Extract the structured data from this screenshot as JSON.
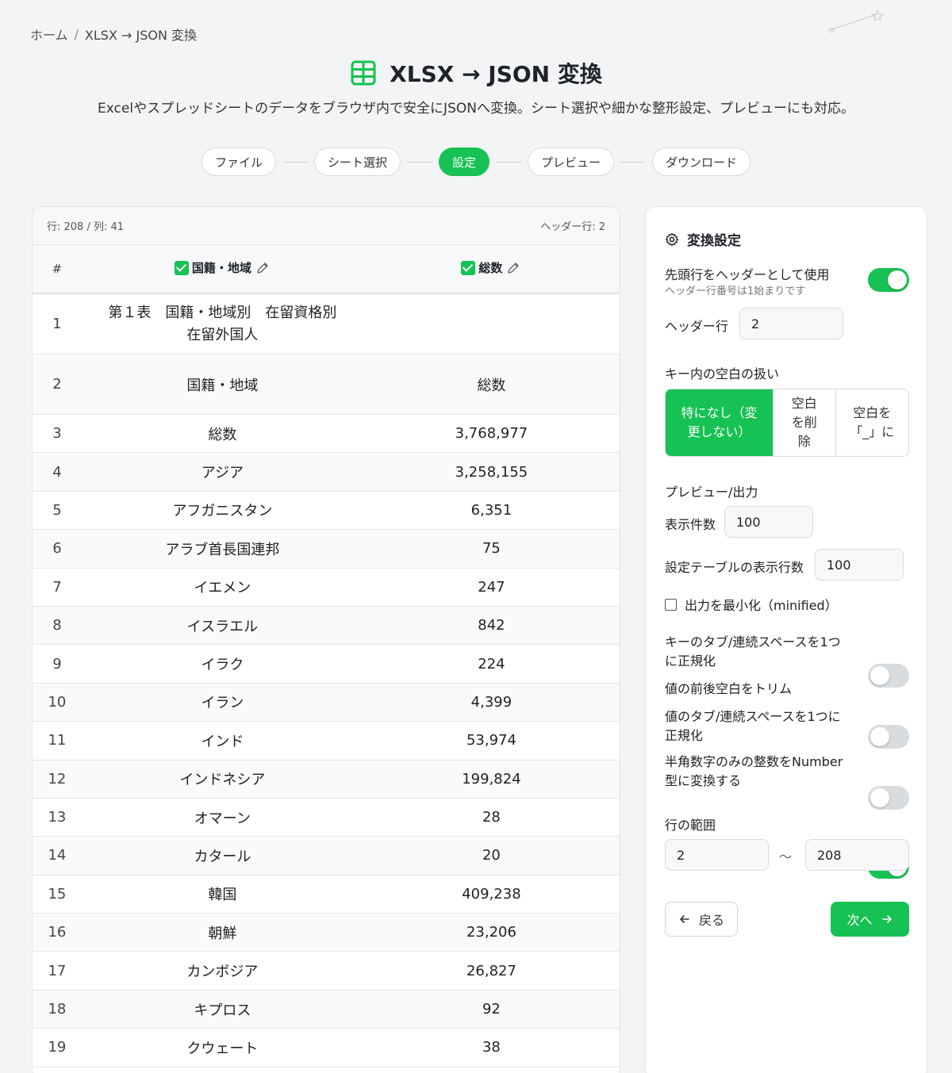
{
  "breadcrumb": {
    "home": "ホーム",
    "separator": "/",
    "current": "XLSX → JSON 変換"
  },
  "header": {
    "title": "XLSX → JSON 変換",
    "icon": "table-icon",
    "subtitle": "Excelやスプレッドシートのデータをブラウザ内で安全にJSONへ変換。シート選択や細かな整形設定、プレビューにも対応。"
  },
  "steps": [
    {
      "label": "ファイル",
      "active": false
    },
    {
      "label": "シート選択",
      "active": false
    },
    {
      "label": "設定",
      "active": true
    },
    {
      "label": "プレビュー",
      "active": false
    },
    {
      "label": "ダウンロード",
      "active": false
    }
  ],
  "table": {
    "meta_left": "行: 208 / 列: 41",
    "meta_right": "ヘッダー行: 2",
    "columns": {
      "num": "#",
      "a": "国籍・地域",
      "b": "総数"
    },
    "rows": [
      {
        "n": "1",
        "a": "第１表　国籍・地域別　在留資格別\n在留外国人",
        "b": ""
      },
      {
        "n": "2",
        "a": "国籍・地域",
        "b": "総数"
      },
      {
        "n": "3",
        "a": "総数",
        "b": "3,768,977"
      },
      {
        "n": "4",
        "a": "アジア",
        "b": "3,258,155"
      },
      {
        "n": "5",
        "a": "アフガニスタン",
        "b": "6,351"
      },
      {
        "n": "6",
        "a": "アラブ首長国連邦",
        "b": "75"
      },
      {
        "n": "7",
        "a": "イエメン",
        "b": "247"
      },
      {
        "n": "8",
        "a": "イスラエル",
        "b": "842"
      },
      {
        "n": "9",
        "a": "イラク",
        "b": "224"
      },
      {
        "n": "10",
        "a": "イラン",
        "b": "4,399"
      },
      {
        "n": "11",
        "a": "インド",
        "b": "53,974"
      },
      {
        "n": "12",
        "a": "インドネシア",
        "b": "199,824"
      },
      {
        "n": "13",
        "a": "オマーン",
        "b": "28"
      },
      {
        "n": "14",
        "a": "カタール",
        "b": "20"
      },
      {
        "n": "15",
        "a": "韓国",
        "b": "409,238"
      },
      {
        "n": "16",
        "a": "朝鮮",
        "b": "23,206"
      },
      {
        "n": "17",
        "a": "カンボジア",
        "b": "26,827"
      },
      {
        "n": "18",
        "a": "キプロス",
        "b": "92"
      },
      {
        "n": "19",
        "a": "クウェート",
        "b": "38"
      }
    ]
  },
  "settings": {
    "title": "変換設定",
    "use_header": {
      "label": "先頭行をヘッダーとして使用",
      "hint": "ヘッダー行番号は1始まりです",
      "on": true
    },
    "header_row": {
      "label": "ヘッダー行",
      "value": "2"
    },
    "whitespace": {
      "label": "キー内の空白の扱い",
      "options": [
        "特になし（変更しない）",
        "空白を削除",
        "空白を「_」に"
      ]
    },
    "preview_section": "プレビュー/出力",
    "display_count": {
      "label": "表示件数",
      "value": "100"
    },
    "table_rows": {
      "label": "設定テーブルの表示行数",
      "value": "100"
    },
    "minify": {
      "label": "出力を最小化（minified）",
      "checked": false
    },
    "toggles": [
      {
        "label": "キーのタブ/連続スペースを1つに正規化",
        "on": false
      },
      {
        "label": "値の前後空白をトリム",
        "on": false
      },
      {
        "label": "値のタブ/連続スペースを1つに正規化",
        "on": false
      },
      {
        "label": "半角数字のみの整数をNumber型に変換する",
        "on": true
      }
    ],
    "range": {
      "label": "行の範囲",
      "from": "2",
      "sep": "〜",
      "to": "208"
    },
    "back_label": "戻る",
    "next_label": "次へ"
  },
  "colors": {
    "accent": "#16c253",
    "background": "#f3f4f5"
  }
}
